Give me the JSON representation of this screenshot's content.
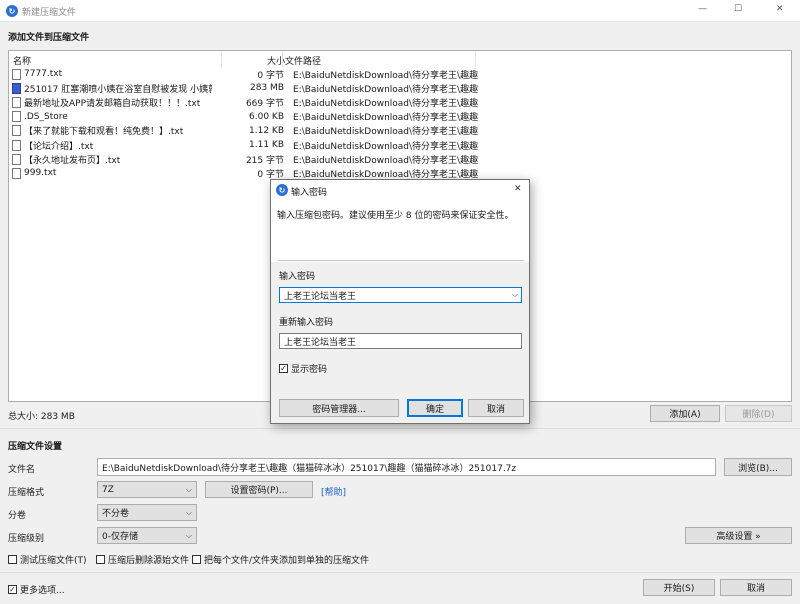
{
  "window": {
    "title": "新建压缩文件",
    "minimize_label": "—",
    "maximize_label": "☐",
    "close_label": "✕"
  },
  "file_section": {
    "heading": "添加文件到压缩文件",
    "columns": {
      "name": "名称",
      "size": "大小",
      "path": "文件路径"
    },
    "rows": [
      {
        "name": "7777.txt",
        "size": "0 字节",
        "path": "E:\\BaiduNetdiskDownload\\待分享老王\\趣趣（",
        "icon": "text-file-icon"
      },
      {
        "name": "251017 肛塞潮喷小姨在浴室自慰被发现 小姨就让...",
        "size": "283 MB",
        "path": "E:\\BaiduNetdiskDownload\\待分享老王\\趣趣（",
        "icon": "image-file-icon"
      },
      {
        "name": "最新地址及APP请发邮箱自动获取！！！.txt",
        "size": "669 字节",
        "path": "E:\\BaiduNetdiskDownload\\待分享老王\\趣趣（",
        "icon": "text-file-icon"
      },
      {
        "name": ".DS_Store",
        "size": "6.00 KB",
        "path": "E:\\BaiduNetdiskDownload\\待分享老王\\趣趣（",
        "icon": "file-icon"
      },
      {
        "name": "【来了就能下载和观看！纯免费！】.txt",
        "size": "1.12 KB",
        "path": "E:\\BaiduNetdiskDownload\\待分享老王\\趣趣（",
        "icon": "text-file-icon"
      },
      {
        "name": "【论坛介绍】.txt",
        "size": "1.11 KB",
        "path": "E:\\BaiduNetdiskDownload\\待分享老王\\趣趣（",
        "icon": "text-file-icon"
      },
      {
        "name": "【永久地址发布页】.txt",
        "size": "215 字节",
        "path": "E:\\BaiduNetdiskDownload\\待分享老王\\趣趣（",
        "icon": "text-file-icon"
      },
      {
        "name": "999.txt",
        "size": "0 字节",
        "path": "E:\\BaiduNetdiskDownload\\待分享老王\\趣趣（",
        "icon": "text-file-icon"
      }
    ],
    "total_size": "总大小: 283 MB",
    "add_label": "添加(A)",
    "delete_label": "删除(D)"
  },
  "settings": {
    "heading": "压缩文件设置",
    "filename_label": "文件名",
    "filename_value": "E:\\BaiduNetdiskDownload\\待分享老王\\趣趣（猫猫碎冰冰）251017\\趣趣（猫猫碎冰冰）251017.7z",
    "browse_label": "浏览(B)...",
    "format_label": "压缩格式",
    "format_value": "7Z",
    "set_password_label": "设置密码(P)...",
    "help_label": "[帮助]",
    "split_label": "分卷",
    "split_value": "不分卷",
    "level_label": "压缩级别",
    "level_value": "0-仅存储",
    "advanced_label": "高级设置 »",
    "test_label": "测试压缩文件(T)",
    "delete_source_label": "压缩后删除源始文件",
    "separate_label": "把每个文件/文件夹添加到单独的压缩文件",
    "more_options_label": "更多选项...",
    "start_label": "开始(S)",
    "cancel_label": "取消"
  },
  "password_dialog": {
    "title": "输入密码",
    "close_label": "✕",
    "description": "输入压缩包密码。建议使用至少 8 位的密码来保证安全性。",
    "password_label": "输入密码",
    "password_value": "上老王论坛当老王",
    "repeat_label": "重新输入密码",
    "repeat_value": "上老王论坛当老王",
    "show_password_label": "显示密码",
    "show_password_checked": "✓",
    "manager_label": "密码管理器...",
    "ok_label": "确定",
    "cancel_label": "取消"
  }
}
